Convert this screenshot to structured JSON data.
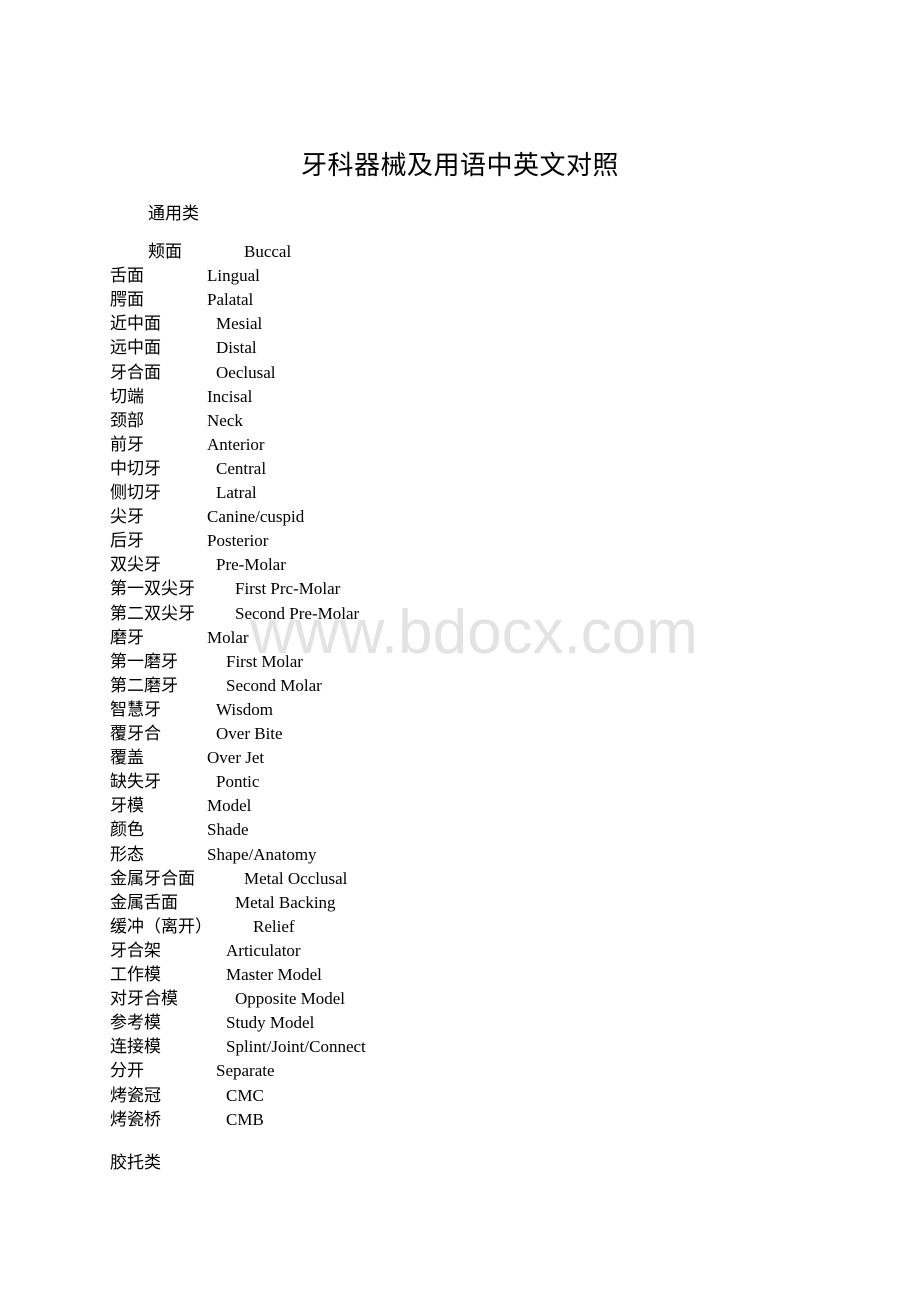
{
  "document": {
    "title": "牙科器械及用语中英文对照",
    "watermark": "www.bdocx.com",
    "sections": [
      {
        "heading": "通用类",
        "terms": [
          {
            "zh": "颊面",
            "en": "Buccal"
          },
          {
            "zh": "舌面",
            "en": "Lingual"
          },
          {
            "zh": "腭面",
            "en": "Palatal"
          },
          {
            "zh": "近中面",
            "en": "Mesial"
          },
          {
            "zh": "远中面",
            "en": "Distal"
          },
          {
            "zh": "牙合面",
            "en": "Oeclusal"
          },
          {
            "zh": "切端",
            "en": "Incisal"
          },
          {
            "zh": "颈部",
            "en": "Neck"
          },
          {
            "zh": "前牙",
            "en": "Anterior"
          },
          {
            "zh": "中切牙",
            "en": "Central"
          },
          {
            "zh": "侧切牙",
            "en": "Latral"
          },
          {
            "zh": "尖牙",
            "en": "Canine/cuspid"
          },
          {
            "zh": "后牙",
            "en": "Posterior"
          },
          {
            "zh": "双尖牙",
            "en": "Pre-Molar"
          },
          {
            "zh": "第一双尖牙",
            "en": "First Prc-Molar"
          },
          {
            "zh": "第二双尖牙",
            "en": "Second Pre-Molar"
          },
          {
            "zh": "磨牙",
            "en": "Molar"
          },
          {
            "zh": "第一磨牙",
            "en": "First Molar"
          },
          {
            "zh": "第二磨牙",
            "en": "Second Molar"
          },
          {
            "zh": "智慧牙",
            "en": "Wisdom"
          },
          {
            "zh": "覆牙合",
            "en": "Over Bite"
          },
          {
            "zh": "覆盖",
            "en": "Over Jet"
          },
          {
            "zh": "缺失牙",
            "en": "Pontic"
          },
          {
            "zh": "牙模",
            "en": "Model"
          },
          {
            "zh": "颜色",
            "en": "Shade"
          },
          {
            "zh": "形态",
            "en": "Shape/Anatomy"
          },
          {
            "zh": "金属牙合面",
            "en": "Metal Occlusal"
          },
          {
            "zh": "金属舌面",
            "en": "Metal Backing"
          },
          {
            "zh": "缓冲（离开）",
            "en": "Relief"
          },
          {
            "zh": "牙合架",
            "en": "Articulator"
          },
          {
            "zh": "工作模",
            "en": "Master Model"
          },
          {
            "zh": "对牙合模",
            "en": "Opposite Model"
          },
          {
            "zh": "参考模",
            "en": "Study Model"
          },
          {
            "zh": "连接模",
            "en": "Splint/Joint/Connect"
          },
          {
            "zh": "分开",
            "en": "Separate"
          },
          {
            "zh": "烤瓷冠",
            "en": "CMC"
          },
          {
            "zh": "烤瓷桥",
            "en": "CMB"
          }
        ]
      },
      {
        "heading": "胶托类",
        "terms": []
      }
    ]
  }
}
